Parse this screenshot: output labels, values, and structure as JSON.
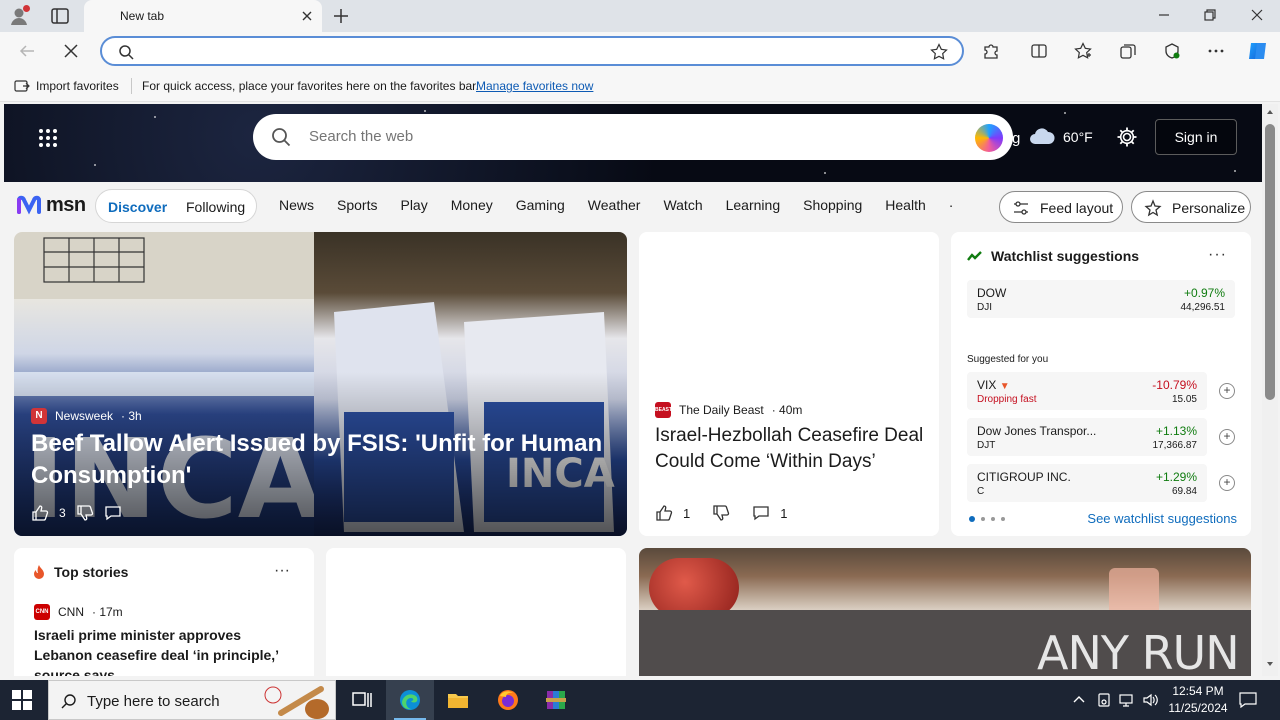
{
  "browser": {
    "tab_title": "New tab",
    "address_value": "",
    "address_placeholder": ""
  },
  "favorites_bar": {
    "import_label": "Import favorites",
    "message": "For quick access, place your favorites here on the favorites bar.",
    "manage_link": "Manage favorites now"
  },
  "msn": {
    "search_placeholder": "Search the web",
    "bing_fragment": "g",
    "weather_temp": "60°F",
    "sign_in": "Sign in",
    "logo_text": "msn",
    "feed_tabs": {
      "discover": "Discover",
      "following": "Following"
    },
    "categories": [
      "News",
      "Sports",
      "Play",
      "Money",
      "Gaming",
      "Weather",
      "Watch",
      "Learning",
      "Shopping",
      "Health",
      "·"
    ],
    "feed_layout": "Feed layout",
    "personalize": "Personalize"
  },
  "hero_card": {
    "source_logo": "N",
    "source": "Newsweek",
    "age": "· 3h",
    "title": "Beef Tallow Alert Issued by FSIS: 'Unfit for Human Consumption'",
    "likes": "3"
  },
  "story_card": {
    "source_logo": "BEAST",
    "source": "The Daily Beast",
    "age": "· 40m",
    "title": "Israel-Hezbollah Ceasefire Deal Could Come ‘Within Days’",
    "likes": "1",
    "comments": "1"
  },
  "watchlist": {
    "title": "Watchlist suggestions",
    "more": "···",
    "primary": {
      "name": "DOW",
      "symbol": "DJI",
      "change": "+0.97%",
      "price": "44,296.51"
    },
    "suggested_label": "Suggested for you",
    "suggested": [
      {
        "name": "VIX",
        "symbol": "Dropping fast",
        "change": "-10.79%",
        "price": "15.05"
      },
      {
        "name": "Dow Jones Transpor...",
        "symbol": "DJT",
        "change": "+1.13%",
        "price": "17,366.87"
      },
      {
        "name": "CITIGROUP INC.",
        "symbol": "C",
        "change": "+1.29%",
        "price": "69.84"
      }
    ],
    "see_more": "See watchlist suggestions"
  },
  "top_stories": {
    "title": "Top stories",
    "more": "···",
    "source_logo": "CNN",
    "source": "CNN",
    "age": "· 17m",
    "headline": "Israeli prime minister approves Lebanon ceasefire deal ‘in principle,’ source says"
  },
  "watermark": {
    "text": "ANY RUN"
  },
  "taskbar": {
    "search_text": "Type here to search",
    "time": "12:54 PM",
    "date": "11/25/2024"
  },
  "colors": {
    "accent": "#0f6cbd",
    "up": "#107c10",
    "down": "#c50f1f",
    "address_border": "#5a8dd6"
  }
}
